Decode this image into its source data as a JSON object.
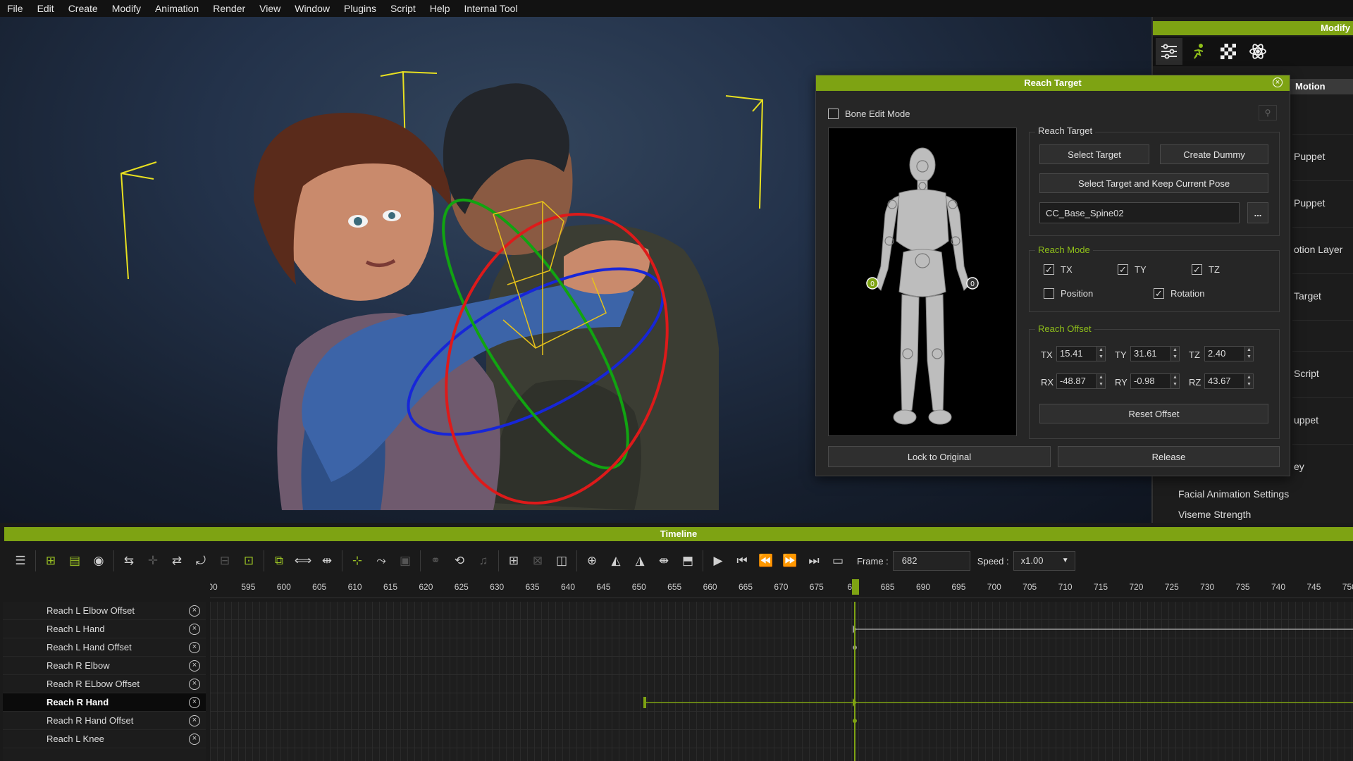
{
  "menu": [
    "File",
    "Edit",
    "Create",
    "Modify",
    "Animation",
    "Render",
    "View",
    "Window",
    "Plugins",
    "Script",
    "Help",
    "Internal Tool"
  ],
  "modify": {
    "title": "Modify",
    "icons": [
      "sliders-icon",
      "motion-figure-icon",
      "checker-icon",
      "atom-icon"
    ],
    "motion_tab": "Motion",
    "side_items": [
      "Puppet",
      "Puppet",
      "otion Layer",
      "Target",
      "",
      "Script",
      "uppet",
      "ey"
    ],
    "facial_settings": "Facial Animation Settings",
    "viseme_strength": "Viseme Strength"
  },
  "dialog": {
    "title": "Reach Target",
    "bone_edit_mode": "Bone Edit Mode",
    "bone_edit_checked": false,
    "reach_target_group": "Reach Target",
    "select_target": "Select Target",
    "create_dummy": "Create  Dummy",
    "select_keep_pose": "Select Target and Keep Current Pose",
    "target_name": "CC_Base_Spine02",
    "browse": "...",
    "reach_mode_group": "Reach Mode",
    "mode": {
      "tx": "TX",
      "ty": "TY",
      "tz": "TZ",
      "position": "Position",
      "rotation": "Rotation"
    },
    "mode_checked": {
      "tx": true,
      "ty": true,
      "tz": true,
      "position": false,
      "rotation": true
    },
    "reach_offset_group": "Reach Offset",
    "offset_labels": {
      "tx": "TX",
      "ty": "TY",
      "tz": "TZ",
      "rx": "RX",
      "ry": "RY",
      "rz": "RZ"
    },
    "offset": {
      "tx": "15.41",
      "ty": "31.61",
      "tz": "2.40",
      "rx": "-48.87",
      "ry": "-0.98",
      "rz": "43.67"
    },
    "reset_offset": "Reset Offset",
    "lock_to_original": "Lock to Original",
    "release": "Release",
    "hand_marker_left": "0",
    "hand_marker_right": "0"
  },
  "timeline": {
    "title": "Timeline",
    "frame_label": "Frame :",
    "frame_value": "682",
    "speed_label": "Speed :",
    "speed_value": "x1.00",
    "ruler": [
      "00",
      "595",
      "600",
      "605",
      "610",
      "615",
      "620",
      "625",
      "630",
      "635",
      "640",
      "645",
      "650",
      "655",
      "660",
      "665",
      "670",
      "675",
      "68",
      "685",
      "690",
      "695",
      "700",
      "705",
      "710",
      "715",
      "720",
      "725",
      "730",
      "735",
      "740",
      "745",
      "750"
    ],
    "current_frame": 682,
    "tracks": [
      {
        "name": "Reach L Elbow Offset",
        "selected": false
      },
      {
        "name": "Reach L Hand",
        "selected": false
      },
      {
        "name": "Reach L Hand Offset",
        "selected": false
      },
      {
        "name": "Reach R Elbow",
        "selected": false
      },
      {
        "name": "Reach R ELbow Offset",
        "selected": false
      },
      {
        "name": "Reach R Hand",
        "selected": true
      },
      {
        "name": "Reach R Hand Offset",
        "selected": false
      },
      {
        "name": "Reach L Knee",
        "selected": false
      }
    ]
  },
  "colors": {
    "accent": "#7ea313",
    "accent_text": "#8fbf1a"
  }
}
